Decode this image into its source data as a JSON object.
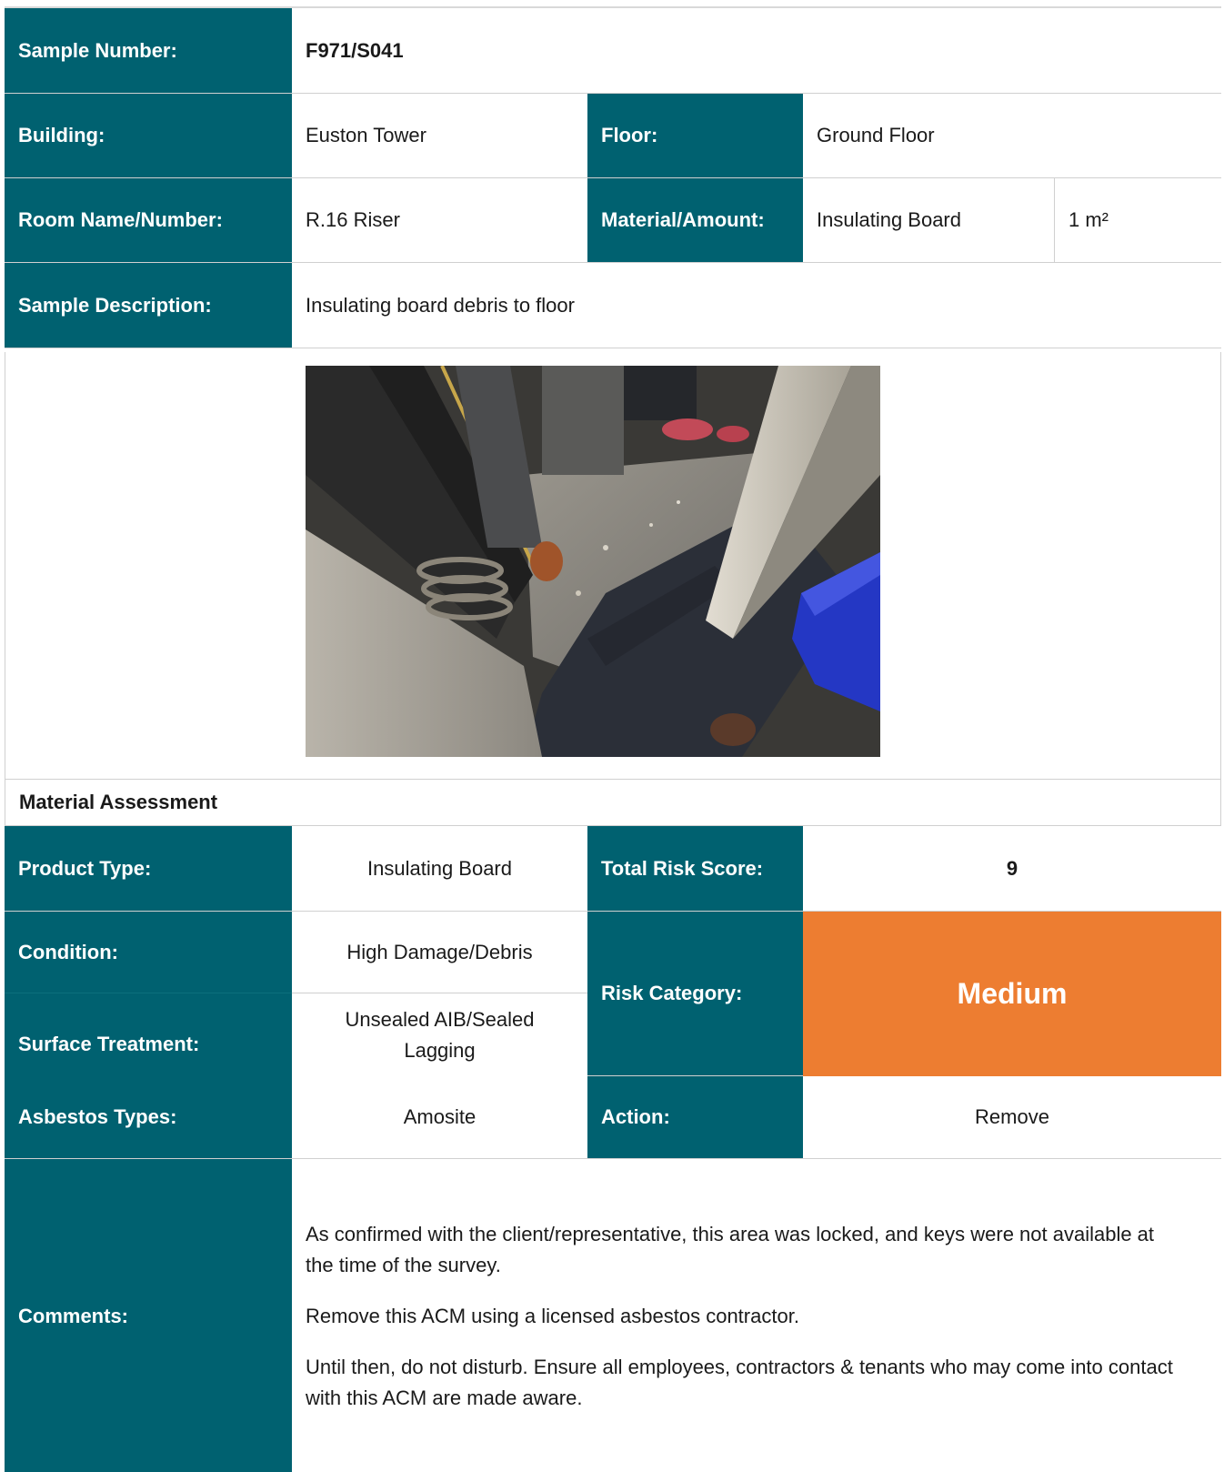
{
  "header": {
    "sample_number_label": "Sample Number:",
    "sample_number_value": "F971/S041",
    "building_label": "Building:",
    "building_value": "Euston Tower",
    "floor_label": "Floor:",
    "floor_value": "Ground Floor",
    "room_label": "Room Name/Number:",
    "room_value": "R.16 Riser",
    "material_label": "Material/Amount:",
    "material_value": "Insulating Board",
    "amount_value": "1 m²",
    "description_label": "Sample Description:",
    "description_value": "Insulating board debris to floor"
  },
  "photo": {
    "icon": "riser-photo"
  },
  "assessment": {
    "section_title": "Material Assessment",
    "product_type_label": "Product Type:",
    "product_type_value": "Insulating Board",
    "total_risk_label": "Total Risk Score:",
    "total_risk_value": "9",
    "condition_label": "Condition:",
    "condition_value": "High Damage/Debris",
    "surface_label": "Surface Treatment:",
    "surface_value": "Unsealed AIB/Sealed Lagging",
    "risk_category_label": "Risk Category:",
    "risk_category_value": "Medium",
    "risk_color": "#ed7d31",
    "asbestos_label": "Asbestos Types:",
    "asbestos_value": "Amosite",
    "action_label": "Action:",
    "action_value": "Remove"
  },
  "comments": {
    "label": "Comments:",
    "paragraphs": [
      "As confirmed with the client/representative, this area was locked, and keys were not available at the time of the survey.",
      "Remove this ACM using a licensed asbestos contractor.",
      "Until then, do not disturb. Ensure all employees, contractors & tenants who may come into contact with this ACM are made aware."
    ]
  },
  "colors": {
    "label_bg": "#006170",
    "risk_medium": "#ed7d31"
  }
}
